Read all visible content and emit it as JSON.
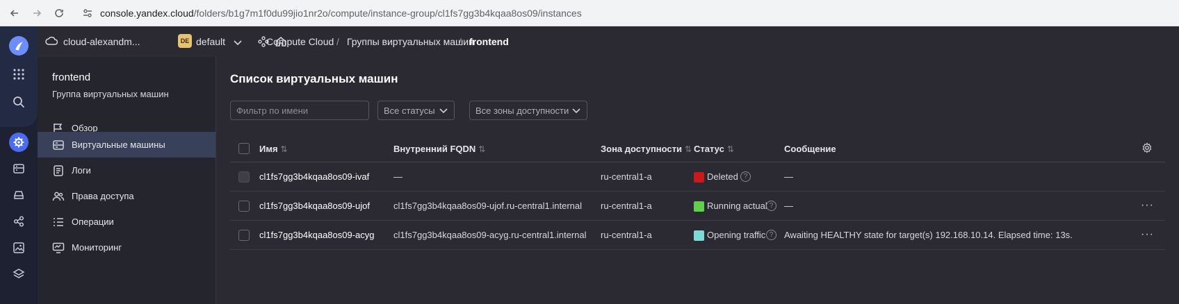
{
  "browser": {
    "url_host": "console.yandex.cloud",
    "url_path": "/folders/b1g7m1f0du99jio1nr2o/compute/instance-group/cl1fs7gg3b4kqaa8os09/instances"
  },
  "header": {
    "cloud": "cloud-alexandm...",
    "folder_badge": "DE",
    "folder": "default",
    "breadcrumbs": [
      "Compute Cloud",
      "Группы виртуальных машин",
      "frontend"
    ],
    "separator": "/"
  },
  "sidebar": {
    "title": "frontend",
    "subtitle": "Группа виртуальных машин",
    "items": [
      {
        "label": "Обзор",
        "icon": "flag-icon"
      },
      {
        "label": "Виртуальные машины",
        "icon": "server-icon",
        "active": true
      },
      {
        "label": "Логи",
        "icon": "log-icon"
      },
      {
        "label": "Права доступа",
        "icon": "users-icon"
      },
      {
        "label": "Операции",
        "icon": "list-icon"
      },
      {
        "label": "Мониторинг",
        "icon": "monitor-icon"
      }
    ]
  },
  "main": {
    "title": "Список виртуальных машин",
    "filter_placeholder": "Фильтр по имени",
    "status_select": "Все статусы",
    "zone_select": "Все зоны доступности",
    "columns": {
      "name": "Имя",
      "fqdn": "Внутренний FQDN",
      "zone": "Зона доступности",
      "status": "Статус",
      "message": "Сообщение"
    },
    "rows": [
      {
        "name": "cl1fs7gg3b4kqaa8os09-ivaf",
        "fqdn": "—",
        "zone": "ru-central1-a",
        "status": "Deleted",
        "status_color": "#c8191c",
        "message": "—",
        "checkbox_disabled": true,
        "menu": ""
      },
      {
        "name": "cl1fs7gg3b4kqaa8os09-ujof",
        "fqdn": "cl1fs7gg3b4kqaa8os09-ujof.ru-central1.internal",
        "zone": "ru-central1-a",
        "status": "Running actual",
        "status_color": "#5fcf4c",
        "message": "—",
        "checkbox_disabled": false,
        "menu": "···"
      },
      {
        "name": "cl1fs7gg3b4kqaa8os09-acyg",
        "fqdn": "cl1fs7gg3b4kqaa8os09-acyg.ru-central1.internal",
        "zone": "ru-central1-a",
        "status": "Opening traffic",
        "status_color": "#7dd9d6",
        "message": "Awaiting HEALTHY state for target(s) 192.168.10.14. Elapsed time: 13s.",
        "checkbox_disabled": false,
        "menu": "···"
      }
    ],
    "sort_icon": "⇅",
    "help_icon": "?"
  },
  "colors": {
    "background": "#2b2a33",
    "sidebar_active": "#39405a",
    "rail": "#1e2132"
  }
}
